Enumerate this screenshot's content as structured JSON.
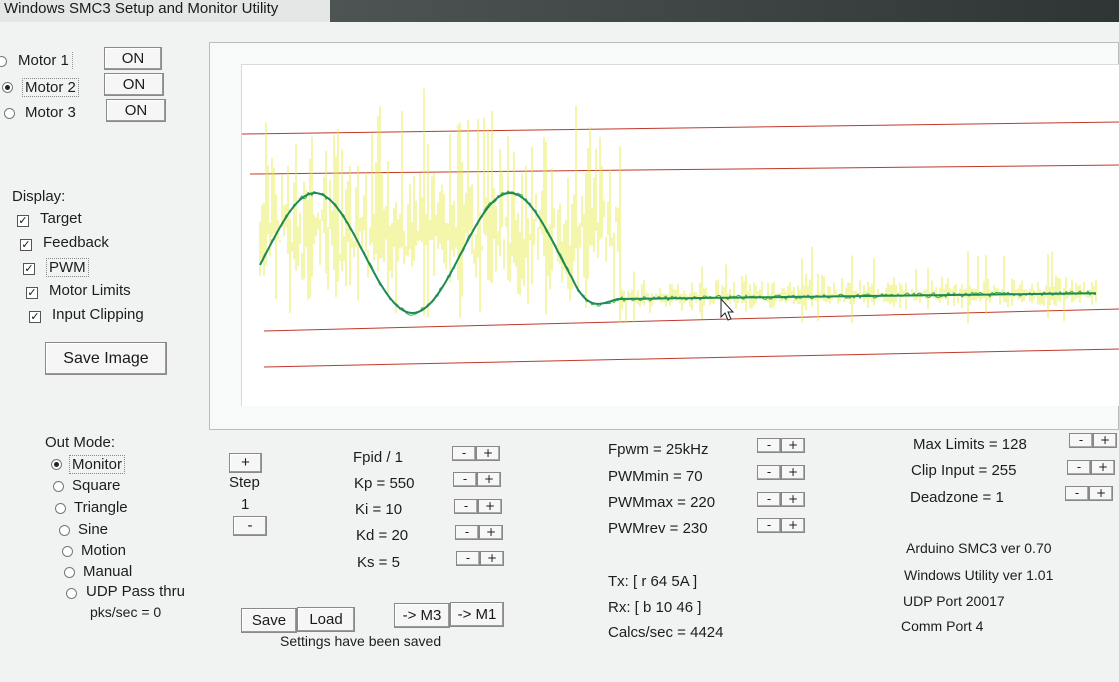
{
  "window": {
    "title": "Windows SMC3 Setup and Monitor Utility"
  },
  "motors": [
    {
      "label": "Motor 1",
      "state": "ON",
      "selected": false
    },
    {
      "label": "Motor 2",
      "state": "ON",
      "selected": true
    },
    {
      "label": "Motor 3",
      "state": "ON",
      "selected": false
    }
  ],
  "display": {
    "heading": "Display:",
    "options": [
      "Target",
      "Feedback",
      "PWM",
      "Motor Limits",
      "Input Clipping"
    ],
    "save_image": "Save Image"
  },
  "out_mode": {
    "heading": "Out Mode:",
    "options": [
      "Monitor",
      "Square",
      "Triangle",
      "Sine",
      "Motion",
      "Manual",
      "UDP Pass thru"
    ],
    "selected": "Monitor",
    "pks_sec": "pks/sec = 0"
  },
  "step": {
    "plus": "+",
    "label": "Step",
    "value": "1",
    "minus": "-"
  },
  "pid": [
    "Fpid / 1",
    "Kp = 550",
    "Ki = 10",
    "Kd = 20",
    "Ks = 5"
  ],
  "pwm": [
    "Fpwm = 25kHz",
    "PWMmin = 70",
    "PWMmax = 220",
    "PWMrev = 230"
  ],
  "limits": [
    "Max Limits = 128",
    "Clip Input = 255",
    "Deadzone = 1"
  ],
  "pm": {
    "minus": "-",
    "plus": "+"
  },
  "comms": {
    "tx": "Tx: [ r 64 5A ]",
    "rx": "Rx: [ b 10 46 ]",
    "calcs": "Calcs/sec = 4424"
  },
  "info": {
    "arduino": "Arduino SMC3 ver 0.70",
    "utility": "Windows Utility ver 1.01",
    "udp": "UDP Port 20017",
    "comm": "Comm Port 4"
  },
  "actions": {
    "save": "Save",
    "load": "Load",
    "to_m3": "-> M3",
    "to_m1": "-> M1",
    "status": "Settings have been saved"
  },
  "colors": {
    "target": "#1f8a57",
    "feedback": "#33b24a",
    "pwm": "#e6ea3a",
    "limit_line": "#c0392b"
  }
}
